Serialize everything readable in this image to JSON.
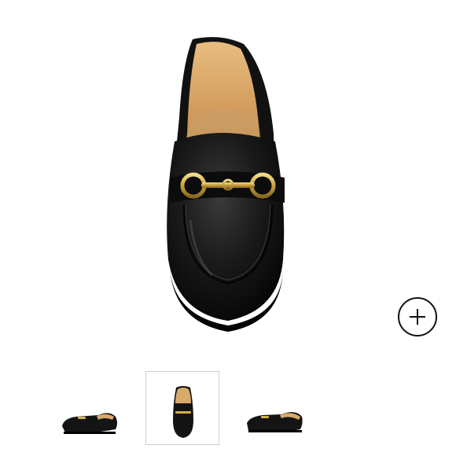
{
  "product_gallery": {
    "main_image": {
      "icon": "loafer-front-view",
      "colors": {
        "leather": "#141414",
        "lining": "#d9a96a",
        "hardware": "#d4b04a"
      }
    },
    "zoom_button": {
      "icon": "plus-circle-icon"
    },
    "thumbnails": [
      {
        "view": "side-view-left",
        "active": false
      },
      {
        "view": "front-view",
        "active": true
      },
      {
        "view": "side-view-right",
        "active": false
      }
    ]
  }
}
